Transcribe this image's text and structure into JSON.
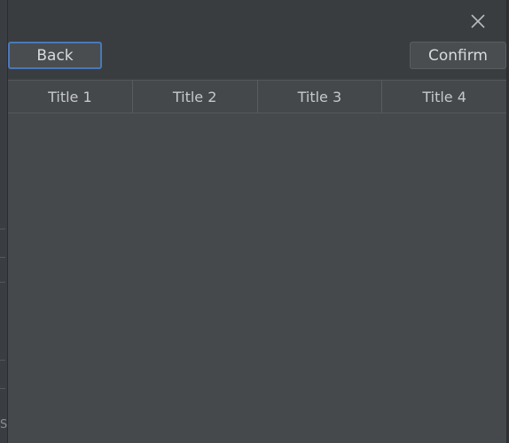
{
  "dialog": {
    "back_label": "Back",
    "confirm_label": "Confirm"
  },
  "table": {
    "columns": [
      "Title 1",
      "Title 2",
      "Title 3",
      "Title 4"
    ]
  },
  "background": {
    "partial_letter": "S"
  },
  "colors": {
    "accent": "#4a78b8",
    "dialog_bg": "#3c3f41",
    "table_bg": "#45494c"
  },
  "icons": {
    "close": "close-icon"
  }
}
